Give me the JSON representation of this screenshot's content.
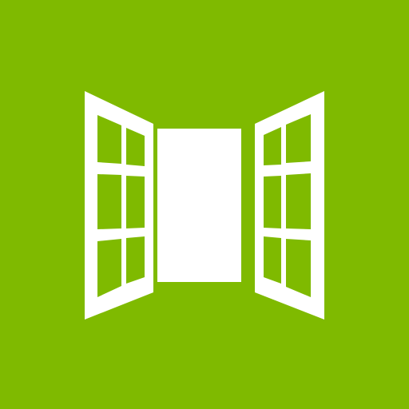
{
  "tile": {
    "icon": "open-window-icon",
    "background_color": "#7FBA00",
    "foreground_color": "#FFFFFF"
  }
}
